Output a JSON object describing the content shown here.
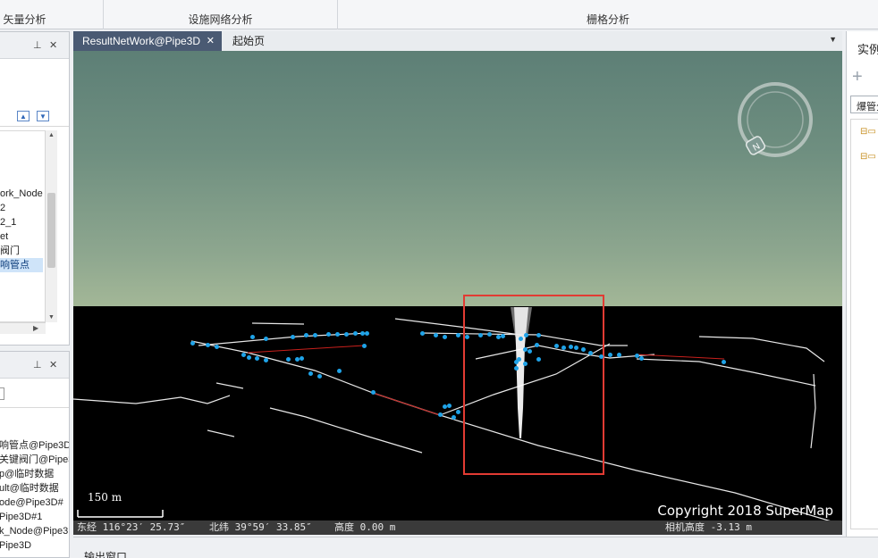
{
  "ribbon": {
    "groups": [
      "矢量分析",
      "设施网络分析",
      "栅格分析"
    ]
  },
  "layers_panel": {
    "items": [
      "ork_Node",
      "2",
      "2_1",
      "et",
      "阀门",
      "响管点"
    ],
    "selected_index": 5
  },
  "workspace_panel": {
    "items": [
      "响管点@Pipe3D",
      "关键阀门@Pipe3D",
      "p@临时数据",
      "ult@临时数据",
      "ode@Pipe3D#",
      "Pipe3D#1",
      "k_Node@Pipe3",
      "Pipe3D"
    ]
  },
  "tabs": [
    {
      "label": "ResultNetWork@Pipe3D",
      "close": "✕"
    },
    {
      "label": "起始页"
    }
  ],
  "scene": {
    "scale_label": "150 m",
    "copyright": "Copyright 2018 SuperMap",
    "compass_letter": "N"
  },
  "status": {
    "longitude": "东经 116°23′ 25.73″",
    "latitude": "北纬 39°59′ 33.85″",
    "altitude": "高度 0.00 m",
    "camera_height": "相机高度 -3.13 m"
  },
  "right_panel": {
    "title": "实例",
    "dropdown": "爆管分"
  },
  "output": {
    "title": "输出窗口"
  },
  "colors": {
    "pipe_node": "#1fa3e8",
    "pipe_line": "#e8e8e8",
    "flow_line": "#c9201c",
    "highlight": "#e23b33"
  }
}
